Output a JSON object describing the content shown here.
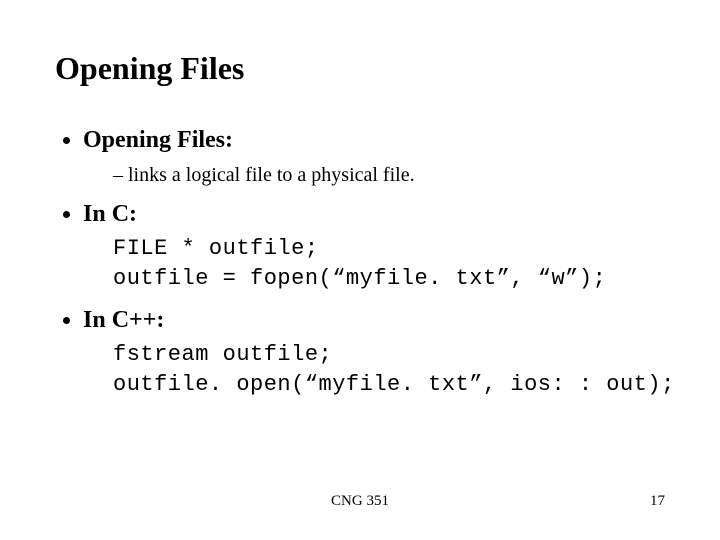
{
  "title": "Opening Files",
  "bullets": {
    "b1": {
      "label": "Opening Files:"
    },
    "b1_sub": "links a logical file to a physical file.",
    "b2": {
      "label": "In C:"
    },
    "b2_code": "FILE * outfile;\noutfile = fopen(“myfile. txt”, “w”);",
    "b3": {
      "label": "In C++:"
    },
    "b3_code": "fstream outfile;\noutfile. open(“myfile. txt”, ios: : out);"
  },
  "footer": {
    "course": "CNG 351",
    "page": "17"
  }
}
